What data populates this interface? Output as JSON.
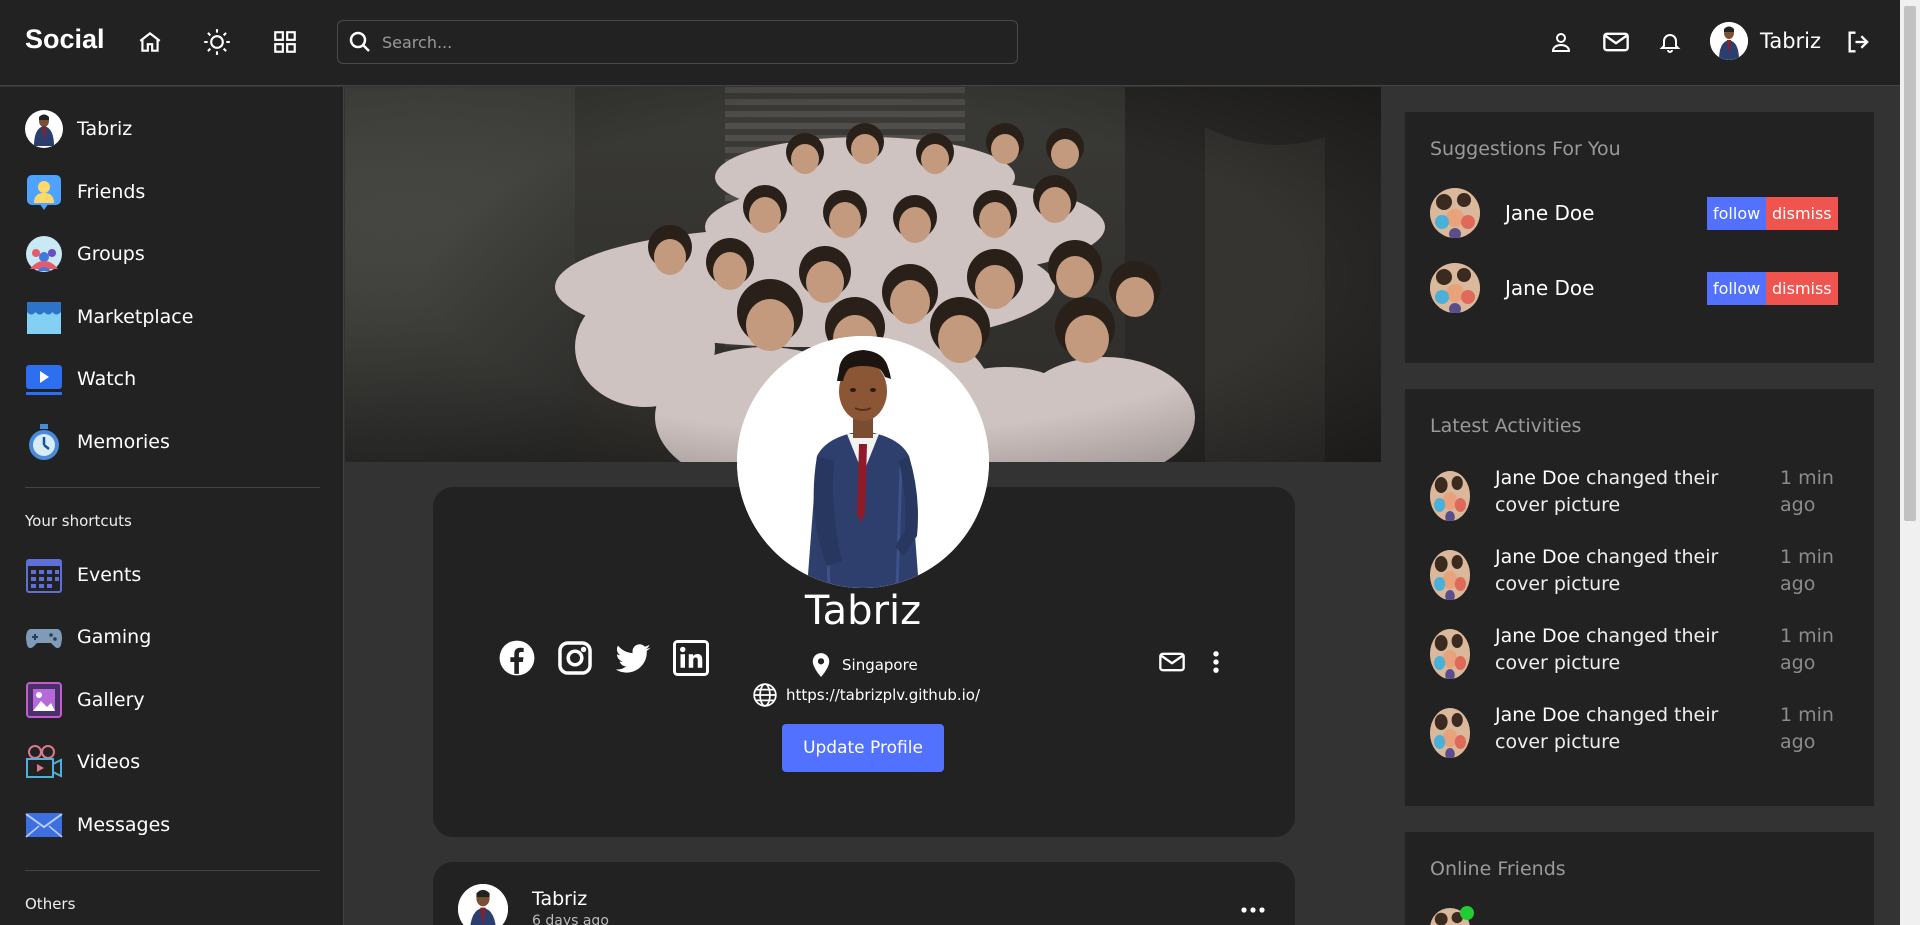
{
  "navbar": {
    "logo": "Social",
    "search_placeholder": "Search...",
    "username": "Tabriz"
  },
  "leftbar": {
    "top_items": [
      {
        "label": "Tabriz",
        "icon": "avatar"
      },
      {
        "label": "Friends",
        "icon": "friends-icon"
      },
      {
        "label": "Groups",
        "icon": "groups-icon"
      },
      {
        "label": "Marketplace",
        "icon": "marketplace-icon"
      },
      {
        "label": "Watch",
        "icon": "watch-icon"
      },
      {
        "label": "Memories",
        "icon": "memories-icon"
      }
    ],
    "shortcuts_heading": "Your shortcuts",
    "shortcuts": [
      {
        "label": "Events",
        "icon": "events-icon"
      },
      {
        "label": "Gaming",
        "icon": "gaming-icon"
      },
      {
        "label": "Gallery",
        "icon": "gallery-icon"
      },
      {
        "label": "Videos",
        "icon": "videos-icon"
      },
      {
        "label": "Messages",
        "icon": "messages-icon"
      }
    ],
    "others_heading": "Others"
  },
  "profile": {
    "name": "Tabriz",
    "location": "Singapore",
    "website": "https://tabrizplv.github.io/",
    "update_label": "Update Profile"
  },
  "post": {
    "author": "Tabriz",
    "time": "6 days ago"
  },
  "rightbar": {
    "suggestions_title": "Suggestions For You",
    "suggestions": [
      {
        "name": "Jane Doe",
        "follow": "follow",
        "dismiss": "dismiss"
      },
      {
        "name": "Jane Doe",
        "follow": "follow",
        "dismiss": "dismiss"
      }
    ],
    "activities_title": "Latest Activities",
    "activities": [
      {
        "name": "Jane Doe",
        "text": "changed their cover picture",
        "time": "1 min ago"
      },
      {
        "name": "Jane Doe",
        "text": "changed their cover picture",
        "time": "1 min ago"
      },
      {
        "name": "Jane Doe",
        "text": "changed their cover picture",
        "time": "1 min ago"
      },
      {
        "name": "Jane Doe",
        "text": "changed their cover picture",
        "time": "1 min ago"
      }
    ],
    "online_title": "Online Friends"
  },
  "colors": {
    "accent": "#5271ff",
    "danger": "#f0544f",
    "online": "#22cc33",
    "panel": "#222222",
    "background": "#333333"
  }
}
